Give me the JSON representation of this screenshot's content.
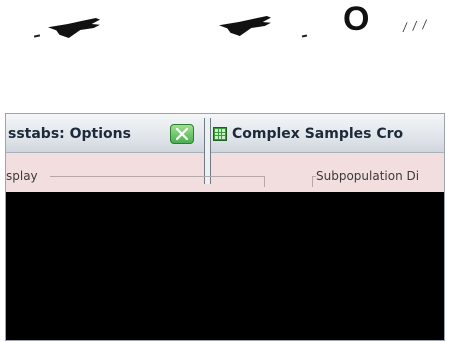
{
  "top_row": {
    "big_glyph": "O",
    "dots": "⁄ ⁄ ⁄"
  },
  "window": {
    "left_tab_title": "sstabs: Options",
    "right_tab_title": "Complex Samples Cro",
    "display_group_label": "splay",
    "subpopulation_group_label": "Subpopulation Di"
  },
  "colors": {
    "window_bg": "#f2dddf",
    "close_button_green": "#4caf50",
    "redaction": "#000000"
  },
  "icons": {
    "close_button": "close-x-icon",
    "app_icon": "grid-table-icon",
    "top_row": [
      "glue-bottle-icon",
      "glue-bottle-icon"
    ]
  }
}
